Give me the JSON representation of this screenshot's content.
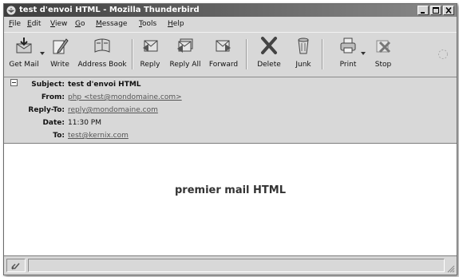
{
  "window": {
    "title": "test d'envoi HTML - Mozilla Thunderbird"
  },
  "menu": {
    "items": [
      {
        "accel": "F",
        "rest": "ile"
      },
      {
        "accel": "E",
        "rest": "dit"
      },
      {
        "accel": "V",
        "rest": "iew"
      },
      {
        "accel": "G",
        "rest": "o"
      },
      {
        "accel": "M",
        "rest": "essage"
      },
      {
        "accel": "T",
        "rest": "ools"
      },
      {
        "accel": "H",
        "rest": "elp"
      }
    ]
  },
  "toolbar": {
    "get_mail": "Get Mail",
    "write": "Write",
    "address_book": "Address Book",
    "reply": "Reply",
    "reply_all": "Reply All",
    "forward": "Forward",
    "delete": "Delete",
    "junk": "Junk",
    "print": "Print",
    "stop": "Stop"
  },
  "headers": {
    "subject_label": "Subject:",
    "subject": "test d'envoi HTML",
    "from_label": "From:",
    "from": "php <test@mondomaine.com>",
    "reply_to_label": "Reply-To:",
    "reply_to": "reply@mondomaine.com",
    "date_label": "Date:",
    "date": "11:30 PM",
    "to_label": "To:",
    "to": "test@kernix.com"
  },
  "message": {
    "body": "premier mail HTML"
  },
  "colors": {
    "titlebar_dark": "#3e3e3e",
    "chrome": "#d8d8d8",
    "link": "#555555"
  }
}
